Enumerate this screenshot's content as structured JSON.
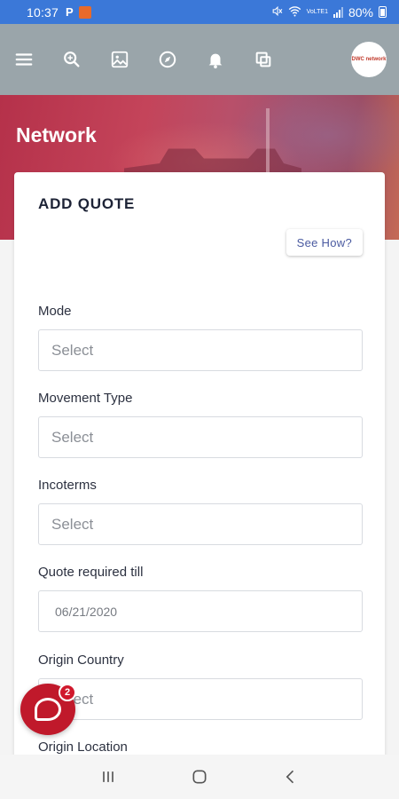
{
  "status_bar": {
    "time": "10:37",
    "p_glyph": "P",
    "network_text": "VoLTE1",
    "battery": "80%"
  },
  "toolbar": {
    "icons": [
      "menu-icon",
      "search-icon",
      "image-icon",
      "compass-icon",
      "bell-icon",
      "copy-icon"
    ],
    "logo_text": "DWC network"
  },
  "hero": {
    "title": "Network"
  },
  "card": {
    "title": "ADD QUOTE",
    "see_how": "See How?",
    "fields": [
      {
        "label": "Mode",
        "value": "Select"
      },
      {
        "label": "Movement Type",
        "value": "Select"
      },
      {
        "label": "Incoterms",
        "value": "Select"
      },
      {
        "label": "Quote required till",
        "value": "06/21/2020"
      },
      {
        "label": "Origin Country",
        "value": "Select"
      },
      {
        "label": "Origin Location",
        "value": ""
      }
    ]
  },
  "chat": {
    "badge_count": "2"
  },
  "colors": {
    "status_bar": "#3b78d8",
    "toolbar": "#9aa5aa",
    "hero": "#b5314a",
    "chat_bubble": "#c0192b",
    "see_how_text": "#4a5aa0"
  }
}
